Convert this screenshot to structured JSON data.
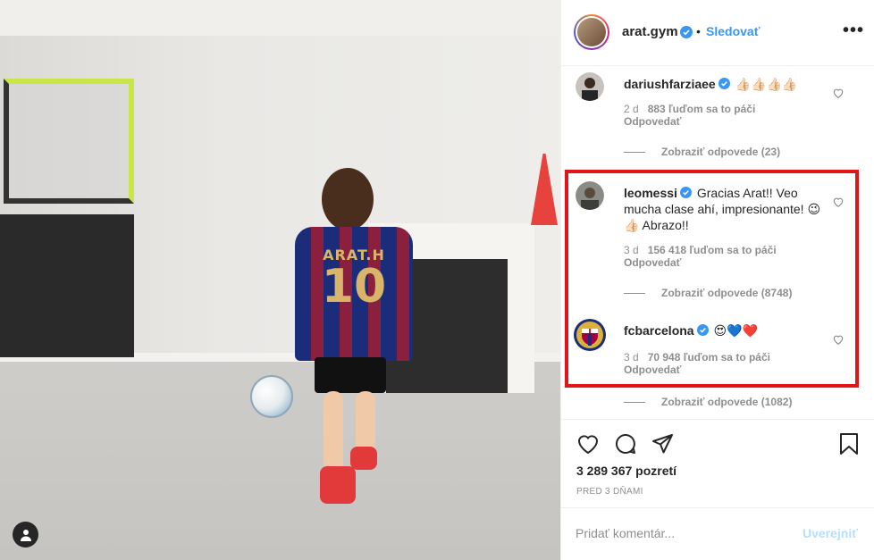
{
  "post": {
    "username": "arat.gym",
    "follow_label": "Sledovať",
    "separator": "•",
    "more_label": "•••",
    "jersey_name": "ARAT.H",
    "jersey_number": "10"
  },
  "comments": [
    {
      "username": "dariushfarziaee",
      "verified": true,
      "text": "👍🏻👍🏻👍🏻👍🏻",
      "ago": "2 d",
      "likes": "883 ľuďom sa to páči",
      "reply_label": "Odpovedať",
      "view_replies": "Zobraziť odpovede (23)"
    },
    {
      "username": "leomessi",
      "verified": true,
      "text": "Gracias Arat!! Veo mucha clase ahí, impresionante! 😉👍🏻 Abrazo!!",
      "ago": "3 d",
      "likes": "156 418 ľuďom sa to páči",
      "reply_label": "Odpovedať",
      "view_replies": "Zobraziť odpovede (8748)"
    },
    {
      "username": "fcbarcelona",
      "verified": true,
      "text": "😍💙❤️",
      "ago": "3 d",
      "likes": "70 948 ľuďom sa to páči",
      "reply_label": "Odpovedať",
      "view_replies": "Zobraziť odpovede (1082)"
    }
  ],
  "stats": {
    "views": "3 289 367 pozretí",
    "time": "PRED 3 DŇAMI"
  },
  "composer": {
    "placeholder": "Pridať komentár...",
    "post_label": "Uverejniť"
  },
  "colors": {
    "link_blue": "#3897f0",
    "verified_blue": "#3897f0",
    "highlight_red": "#e0141a",
    "post_disabled": "#b2dffc"
  }
}
